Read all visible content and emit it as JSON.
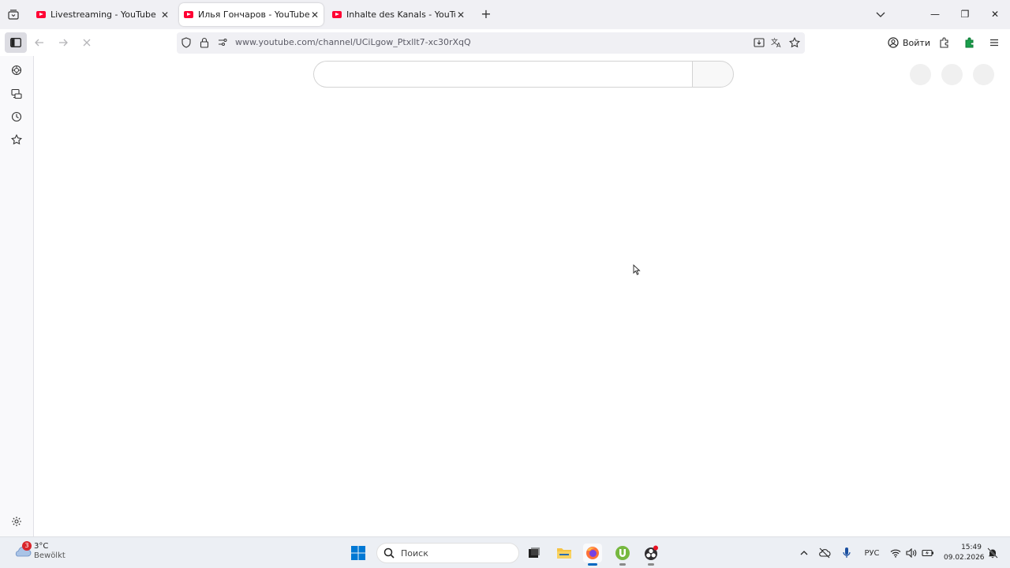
{
  "browser": {
    "tabs": [
      {
        "title": "Livestreaming - YouTube Studio",
        "active": false
      },
      {
        "title": "Илья Гончаров - YouTube",
        "active": true
      },
      {
        "title": "Inhalte des Kanals - YouTube Studio",
        "active": false
      }
    ],
    "url": "www.youtube.com/channel/UCiLgow_Ptxllt7-xc30rXqQ",
    "signin_label": "Войти",
    "icons": {
      "tab_list": "tab-list-icon",
      "new_tab": "+",
      "back": "back-arrow-icon",
      "forward": "forward-arrow-icon",
      "stop": "stop-loading-icon",
      "shield": "tracking-protection-icon",
      "lock": "lock-icon",
      "permissions": "permissions-icon",
      "install": "install-app-icon",
      "translate": "translate-icon",
      "bookmark": "star-icon"
    }
  },
  "window_controls": {
    "minimize": "—",
    "maximize": "❐",
    "close": "✕"
  },
  "sidebar": {
    "icons": [
      "ai-chatbot-icon",
      "synced-tabs-icon",
      "history-icon",
      "bookmarks-icon"
    ],
    "settings": "gear-icon"
  },
  "taskbar": {
    "weather": {
      "temp": "3°C",
      "desc": "Bewölkt",
      "badge": "3"
    },
    "search_placeholder": "Поиск",
    "language": "РУС",
    "time": "15:49",
    "date": "09.02.2026"
  },
  "colors": {
    "tabstrip_bg": "#f0f0f4",
    "youtube_red": "#ff0033",
    "taskbar_bg": "#eceff4",
    "windows_blue": "#0078d4"
  }
}
